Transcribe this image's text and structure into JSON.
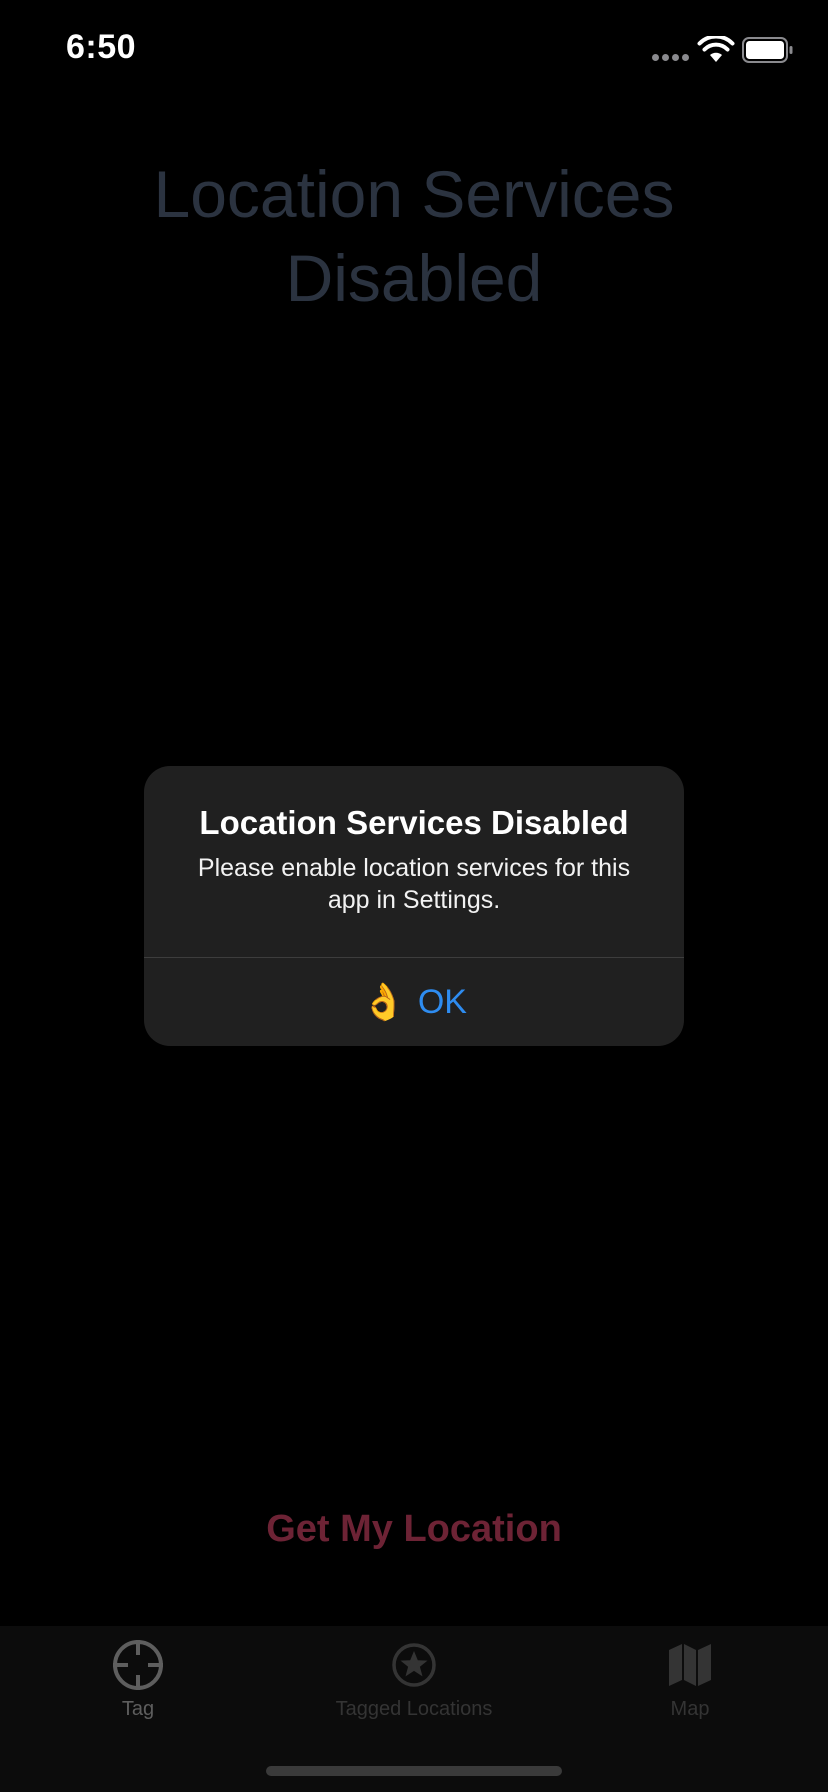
{
  "status_bar": {
    "time": "6:50"
  },
  "main": {
    "title_line1": "Location Services",
    "title_line2": "Disabled",
    "get_location_label": "Get My Location"
  },
  "alert": {
    "title": "Location Services Disabled",
    "message": "Please enable location services for this app in Settings.",
    "ok_emoji": "👌",
    "ok_label": "OK"
  },
  "tab_bar": {
    "tabs": [
      {
        "label": "Tag",
        "icon": "crosshair-icon",
        "selected": true
      },
      {
        "label": "Tagged Locations",
        "icon": "star-circle-icon",
        "selected": false
      },
      {
        "label": "Map",
        "icon": "map-icon",
        "selected": false
      }
    ]
  },
  "colors": {
    "background": "#000000",
    "title_dimmed": "#2b3340",
    "button_dimmed": "#6d2335",
    "alert_background": "#202020",
    "alert_action": "#2e8cf0"
  }
}
